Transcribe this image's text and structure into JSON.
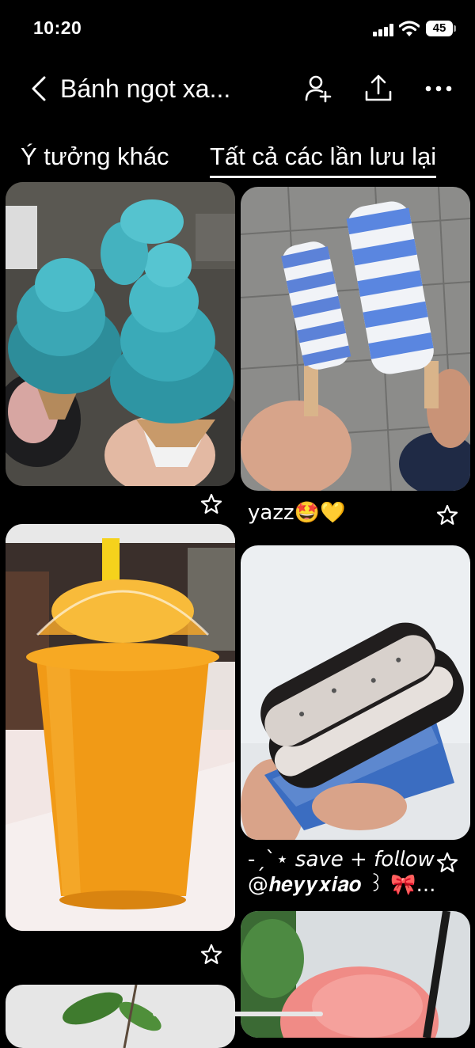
{
  "status_bar": {
    "time": "10:20",
    "battery": "45"
  },
  "header": {
    "title": "Bánh ngọt xa..."
  },
  "tabs": [
    {
      "label": "Ý tưởng khác",
      "active": false
    },
    {
      "label": "Tất cả các lần lưu lại",
      "active": true
    }
  ],
  "pins": [
    {
      "subject": "blue soft-serve ice cream cones",
      "caption": ""
    },
    {
      "subject": "blue and white twist popsicles",
      "caption": "yazz🤩💛"
    },
    {
      "subject": "mango smoothie in plastic cup",
      "caption": ""
    },
    {
      "subject": "oreo ice cream sandwich",
      "caption_line1": "-ˏˋ⋆ 𝘴𝘢𝘷𝘦 + 𝘧𝘰𝘭𝘭𝘰𝘸",
      "caption_line2": "@𝒉𝒆𝒚𝒚𝒙𝒊𝒂𝒐 ꒱ 🎀..."
    },
    {
      "subject": "pink sorbet scoop"
    },
    {
      "subject": "green leaves"
    }
  ],
  "icons": {
    "back": "chevron-left-icon",
    "add_collaborator": "add-person-icon",
    "share": "share-icon",
    "more": "more-horizontal-icon",
    "save": "star-icon"
  }
}
